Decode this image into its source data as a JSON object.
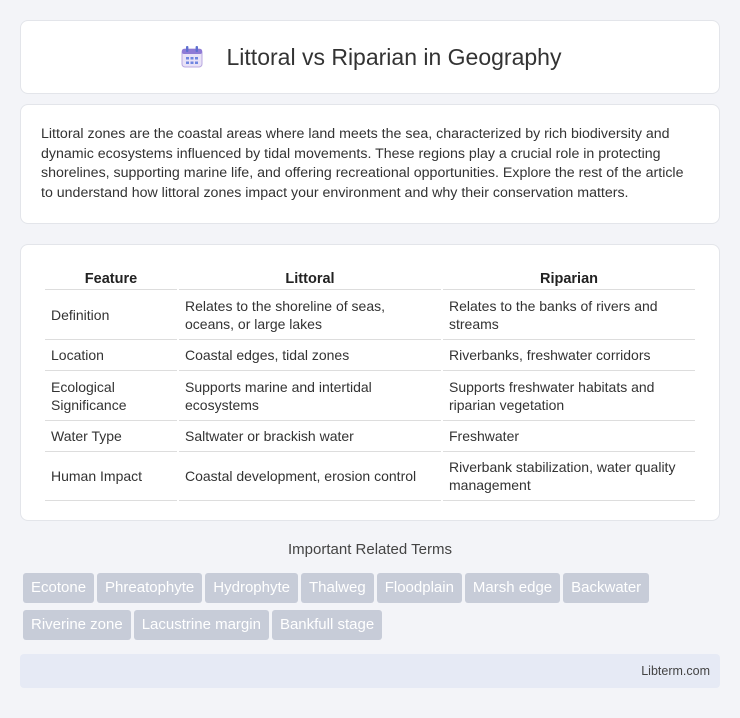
{
  "header": {
    "title": "Littoral vs Riparian in Geography",
    "icon": "calendar-icon"
  },
  "intro": {
    "text": "Littoral zones are the coastal areas where land meets the sea, characterized by rich biodiversity and dynamic ecosystems influenced by tidal movements. These regions play a crucial role in protecting shorelines, supporting marine life, and offering recreational opportunities. Explore the rest of the article to understand how littoral zones impact your environment and why their conservation matters."
  },
  "table": {
    "headers": [
      "Feature",
      "Littoral",
      "Riparian"
    ],
    "rows": [
      [
        "Definition",
        "Relates to the shoreline of seas, oceans, or large lakes",
        "Relates to the banks of rivers and streams"
      ],
      [
        "Location",
        "Coastal edges, tidal zones",
        "Riverbanks, freshwater corridors"
      ],
      [
        "Ecological Significance",
        "Supports marine and intertidal ecosystems",
        "Supports freshwater habitats and riparian vegetation"
      ],
      [
        "Water Type",
        "Saltwater or brackish water",
        "Freshwater"
      ],
      [
        "Human Impact",
        "Coastal development, erosion control",
        "Riverbank stabilization, water quality management"
      ]
    ]
  },
  "related": {
    "title": "Important Related Terms",
    "tags": [
      "Ecotone",
      "Phreatophyte",
      "Hydrophyte",
      "Thalweg",
      "Floodplain",
      "Marsh edge",
      "Backwater",
      "Riverine zone",
      "Lacustrine margin",
      "Bankfull stage"
    ]
  },
  "footer": {
    "site": "Libterm.com"
  }
}
